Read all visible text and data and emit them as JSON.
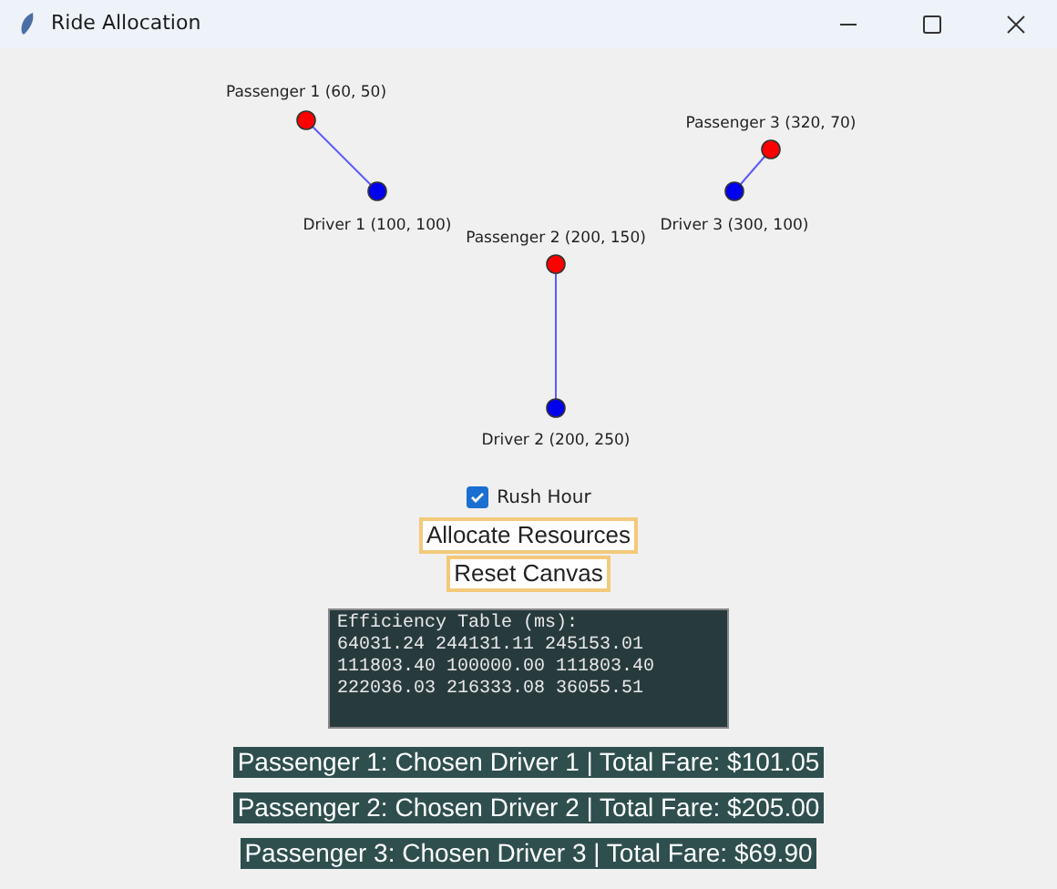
{
  "window": {
    "title": "Ride Allocation"
  },
  "pairs": [
    {
      "passenger": "Passenger 1 (60, 50)",
      "driver": "Driver 1 (100, 100)"
    },
    {
      "passenger": "Passenger 2 (200, 150)",
      "driver": "Driver 2 (200, 250)"
    },
    {
      "passenger": "Passenger 3 (320, 70)",
      "driver": "Driver 3 (300, 100)"
    }
  ],
  "rush_hour": {
    "label": "Rush Hour",
    "checked": true
  },
  "buttons": [
    "Allocate Resources",
    "Reset Canvas"
  ],
  "efficiency_table": {
    "title": "Efficiency Table (ms):",
    "rows": [
      "64031.24 244131.11 245153.01",
      "111803.40 100000.00 111803.40",
      "222036.03 216333.08 36055.51"
    ]
  },
  "results": [
    "Passenger 1: Chosen Driver 1 | Total Fare: $101.05",
    "Passenger 2: Chosen Driver 2 | Total Fare: $205.00",
    "Passenger 3: Chosen Driver 3 | Total Fare: $69.90"
  ]
}
